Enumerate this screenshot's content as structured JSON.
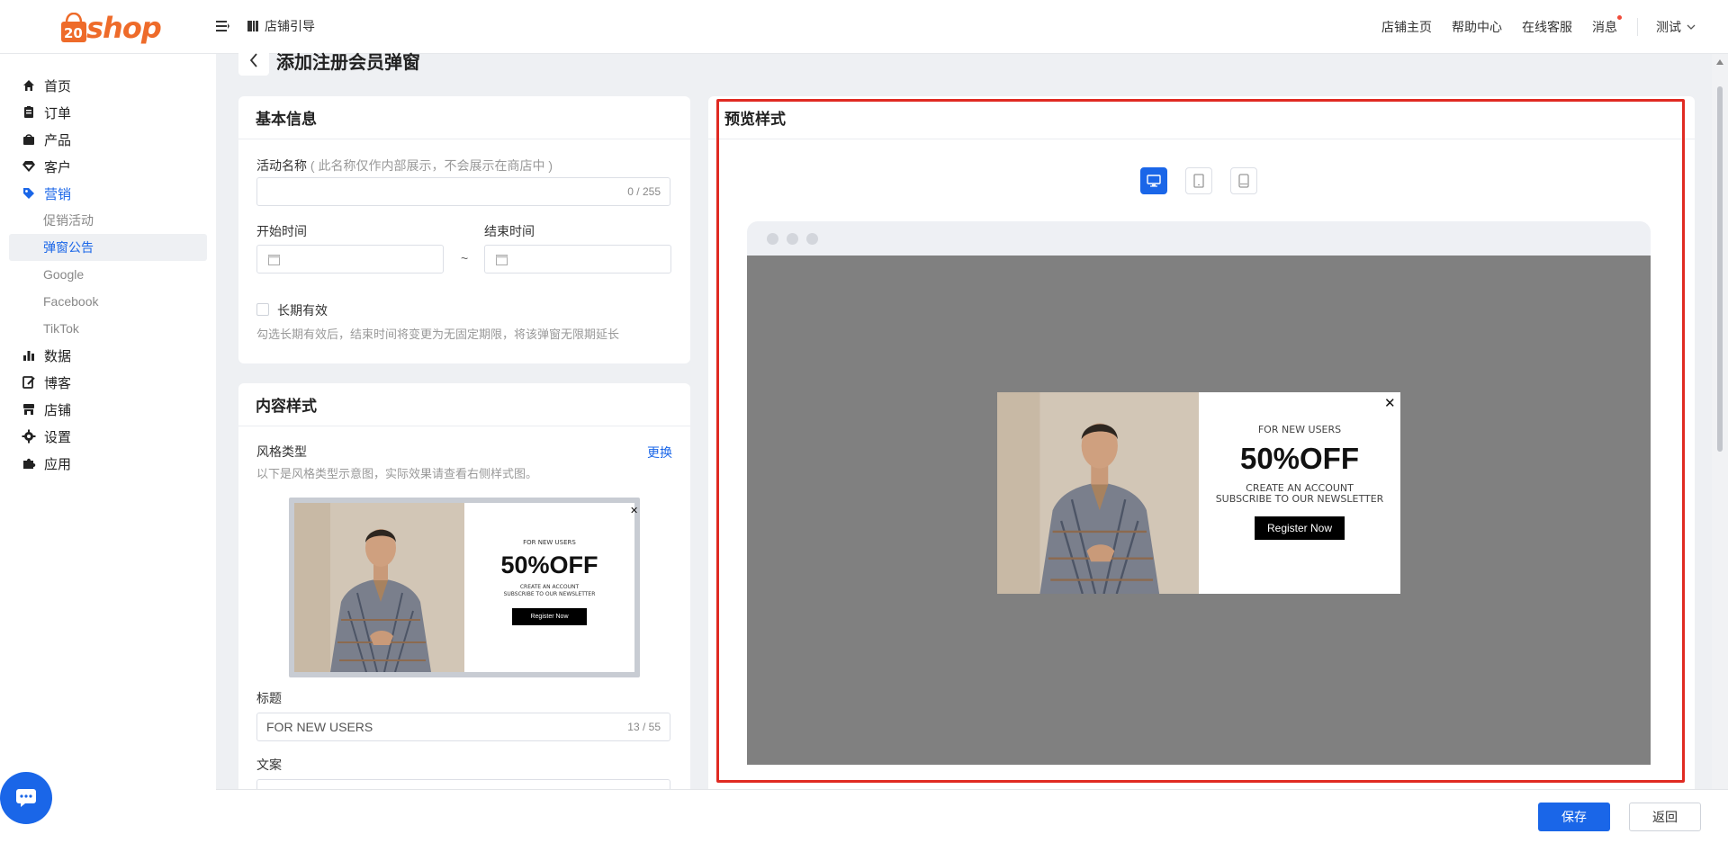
{
  "header": {
    "logo_text": "shop",
    "guide_label": "店铺引导",
    "links": [
      "店铺主页",
      "帮助中心",
      "在线客服",
      "消息"
    ],
    "user_label": "测试"
  },
  "sidebar": {
    "items": [
      {
        "label": "首页",
        "icon": "home-icon"
      },
      {
        "label": "订单",
        "icon": "order-icon"
      },
      {
        "label": "产品",
        "icon": "product-icon"
      },
      {
        "label": "客户",
        "icon": "customer-icon"
      },
      {
        "label": "营销",
        "icon": "marketing-tag-icon",
        "active": true
      }
    ],
    "sub_items": [
      {
        "label": "促销活动"
      },
      {
        "label": "弹窗公告",
        "active": true
      },
      {
        "label": "Google"
      },
      {
        "label": "Facebook"
      },
      {
        "label": "TikTok"
      }
    ],
    "items_after": [
      {
        "label": "数据",
        "icon": "chart-icon"
      },
      {
        "label": "博客",
        "icon": "blog-icon"
      },
      {
        "label": "店铺",
        "icon": "store-icon"
      },
      {
        "label": "设置",
        "icon": "gear-icon"
      },
      {
        "label": "应用",
        "icon": "puzzle-icon"
      }
    ]
  },
  "page": {
    "title": "添加注册会员弹窗"
  },
  "basic_info": {
    "title": "基本信息",
    "name_label": "活动名称",
    "name_hint": "( 此名称仅作内部展示，不会展示在商店中 )",
    "name_counter": "0 / 255",
    "start_label": "开始时间",
    "end_label": "结束时间",
    "range_sep": "~",
    "long_term_label": "长期有效",
    "long_term_hint": "勾选长期有效后，结束时间将变更为无固定期限，将该弹窗无限期延长"
  },
  "content_style": {
    "title": "内容样式",
    "style_type_label": "风格类型",
    "change_link": "更换",
    "style_hint": "以下是风格类型示意图，实际效果请查看右侧样式图。",
    "heading_label": "标题",
    "heading_value": "FOR NEW USERS",
    "heading_counter": "13 / 55",
    "copy_label": "文案"
  },
  "popup": {
    "eyebrow": "FOR NEW USERS",
    "headline": "50%OFF",
    "line1": "CREATE AN ACCOUNT",
    "line2": "SUBSCRIBE TO OUR NEWSLETTER",
    "cta": "Register Now",
    "close": "✕"
  },
  "preview": {
    "title": "预览样式",
    "devices": [
      "desktop-icon",
      "tablet-icon",
      "mobile-icon"
    ],
    "active_device": "desktop-icon"
  },
  "footer": {
    "save_label": "保存",
    "back_label": "返回"
  },
  "colors": {
    "primary": "#1a66e8",
    "brand_orange": "#ee6b2a",
    "highlight_frame": "#e02a22",
    "overlay_gray": "#808080"
  }
}
